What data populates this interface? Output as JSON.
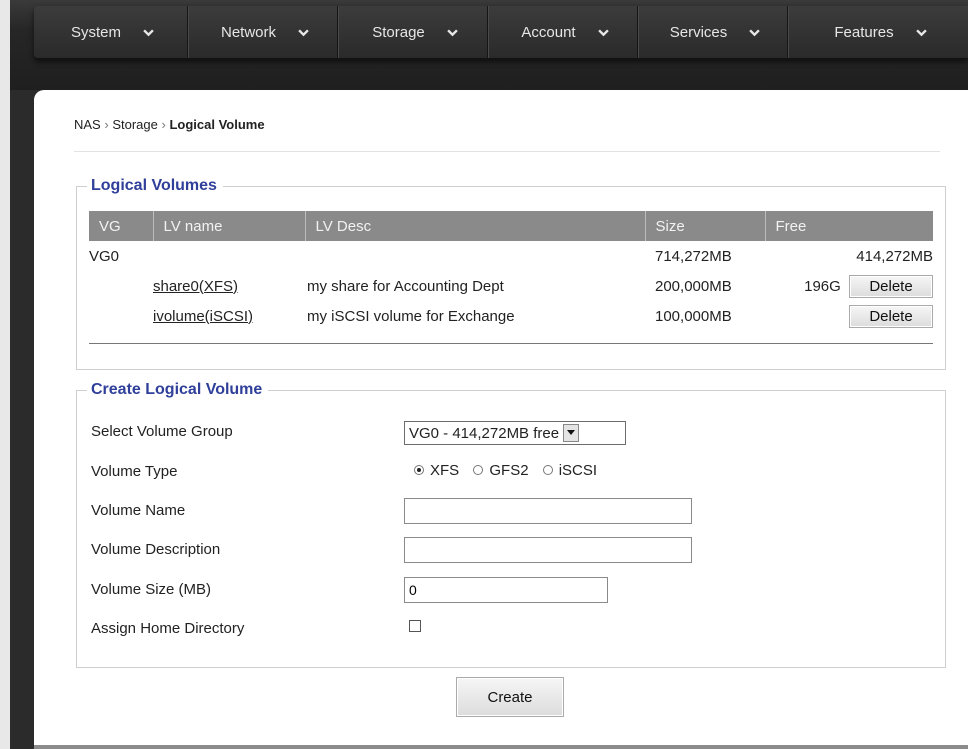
{
  "nav": {
    "menu": [
      {
        "label": "System"
      },
      {
        "label": "Network"
      },
      {
        "label": "Storage"
      },
      {
        "label": "Account"
      },
      {
        "label": "Services"
      },
      {
        "label": "Features"
      }
    ]
  },
  "breadcrumb": {
    "part1": "NAS",
    "sep": "›",
    "part2": "Storage",
    "current": "Logical Volume"
  },
  "logical_volumes": {
    "legend": "Logical Volumes",
    "columns": [
      "VG",
      "LV name",
      "LV Desc",
      "Size",
      "Free"
    ],
    "vg_row": {
      "vg": "VG0",
      "size": "714,272MB",
      "free": "414,272MB"
    },
    "rows": [
      {
        "name": "share0(XFS)",
        "desc": "my share for Accounting Dept",
        "size": "200,000MB",
        "free": "196G",
        "action": "Delete"
      },
      {
        "name": "ivolume(iSCSI)",
        "desc": "my iSCSI volume for Exchange",
        "size": "100,000MB",
        "free": "",
        "action": "Delete"
      }
    ]
  },
  "create": {
    "legend": "Create Logical Volume",
    "labels": {
      "vg": "Select Volume Group",
      "type": "Volume Type",
      "name": "Volume Name",
      "desc": "Volume Description",
      "size": "Volume Size (MB)",
      "home": "Assign Home Directory"
    },
    "vg_select": "VG0 - 414,272MB free",
    "types": [
      "XFS",
      "GFS2",
      "iSCSI"
    ],
    "selected_type": "XFS",
    "name_value": "",
    "desc_value": "",
    "size_value": "0",
    "home_checked": false,
    "button": "Create"
  },
  "colors": {
    "legend_blue": "#2f3f9a",
    "table_header": "#8a8a8a",
    "menubar": "#2a2a2a"
  }
}
